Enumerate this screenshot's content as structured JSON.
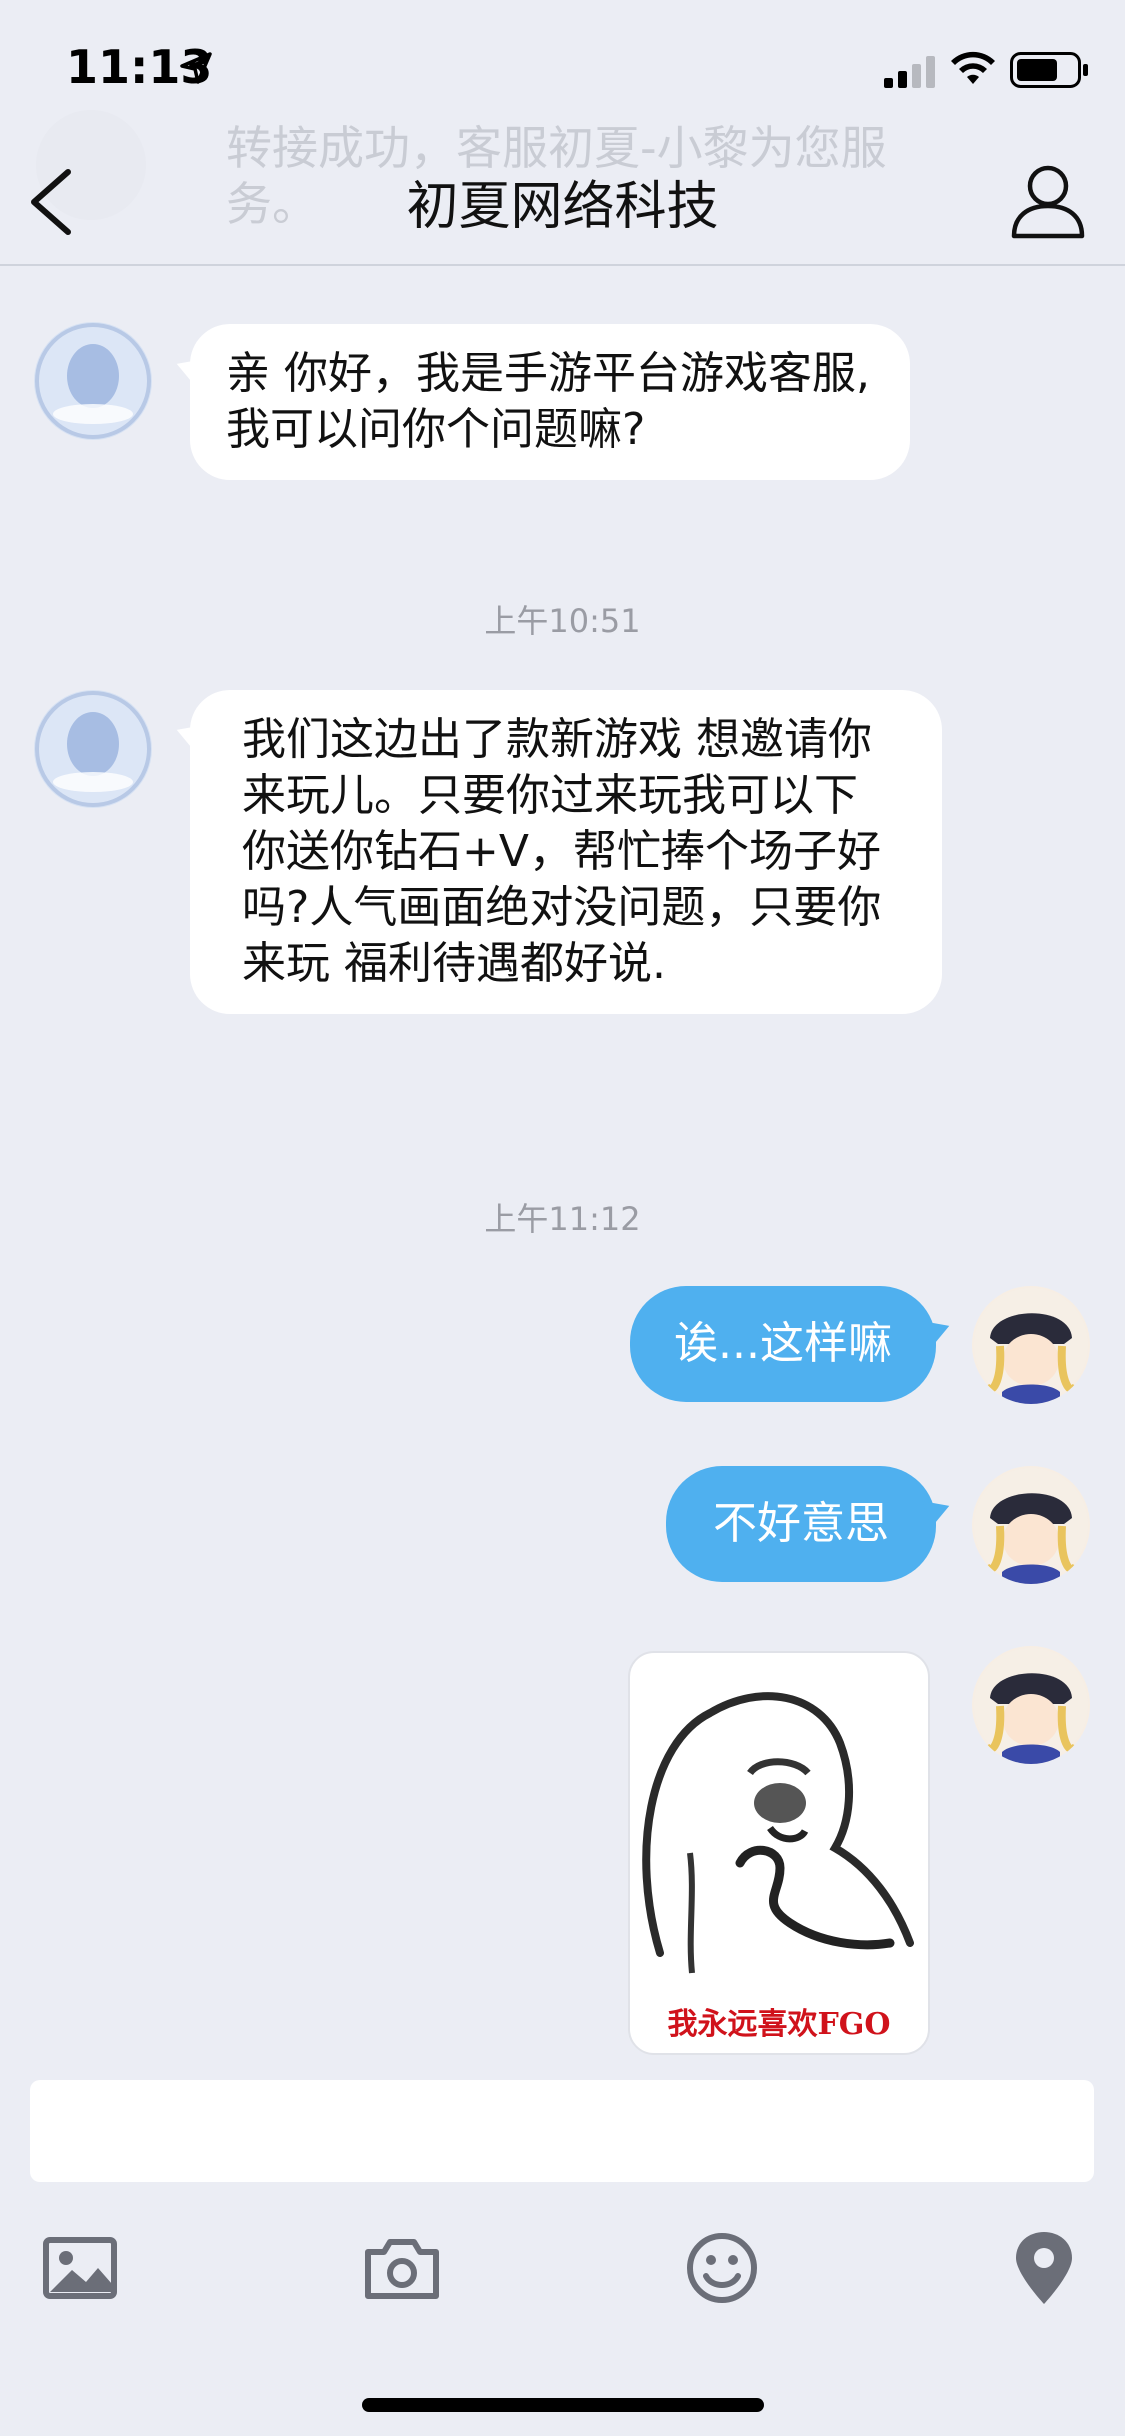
{
  "status_bar": {
    "time": "11:13"
  },
  "nav": {
    "title": "初夏网络科技",
    "ghost_notice": "转接成功，客服初夏-小黎为您服务。"
  },
  "messages": [
    {
      "side": "in",
      "text": "亲 你好，我是手游平台游戏客服,我可以问你个问题嘛?"
    },
    {
      "timestamp": "上午10:51"
    },
    {
      "side": "in",
      "text": "我们这边出了款新游戏 想邀请你来玩儿。只要你过来玩我可以下你送你钻石+V，帮忙捧个场子好吗?人气画面绝对没问题，只要你来玩 福利待遇都好说."
    },
    {
      "timestamp": "上午11:12"
    },
    {
      "side": "out",
      "text": "诶...这样嘛"
    },
    {
      "side": "out",
      "text": "不好意思"
    },
    {
      "side": "out",
      "sticker_caption": "我永远喜欢FGO"
    }
  ],
  "input": {
    "value": "",
    "placeholder": ""
  },
  "toolbar": [
    "image-icon",
    "camera-icon",
    "emoji-icon",
    "location-icon"
  ],
  "colors": {
    "background": "#ebedf4",
    "outgoing_bubble": "#4fb0ef",
    "incoming_bubble": "#ffffff"
  }
}
